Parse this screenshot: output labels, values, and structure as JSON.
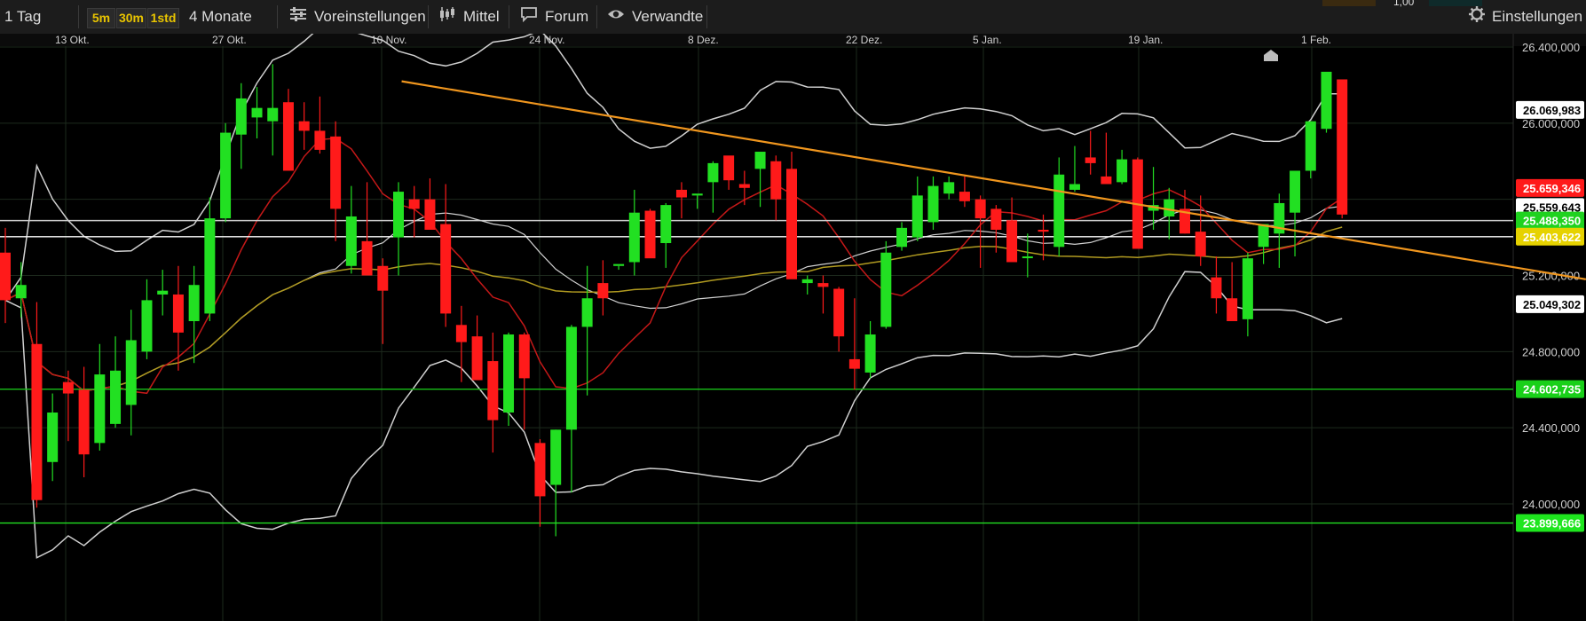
{
  "toolbar": {
    "interval": "1 Tag",
    "timeframes": [
      "5m",
      "30m",
      "1std"
    ],
    "range": "4 Monate",
    "presets": "Voreinstellungen",
    "indicator": "Mittel",
    "forum": "Forum",
    "related": "Verwandte",
    "settings": "Einstellungen"
  },
  "topright": {
    "value": "1,00"
  },
  "colors": {
    "up": "#22e022",
    "down": "#ff1a1a",
    "trendline": "#f0961e",
    "bollinger": "#d0d0d0",
    "ma_red": "#c41818",
    "ma_yellow": "#b09a20",
    "grid": "#1d2a1d"
  },
  "chart_data": {
    "type": "candlestick",
    "x_ticks": [
      "13 Okt.",
      "27 Okt.",
      "10 Nov.",
      "24 Nov.",
      "8 Dez.",
      "22 Dez.",
      "5 Jan.",
      "19 Jan.",
      "1 Feb."
    ],
    "y_ticks": [
      "26.400,000",
      "26.000,000",
      "25.200,000",
      "24.800,000",
      "24.400,000",
      "24.000,000"
    ],
    "ylim": [
      23800000,
      26550000
    ],
    "candles": [
      [
        25320000,
        25450000,
        24950000,
        25070000
      ],
      [
        25080000,
        25270000,
        24980000,
        25150000
      ],
      [
        24840000,
        25060000,
        23980000,
        24020000
      ],
      [
        24220000,
        24580000,
        24120000,
        24480000
      ],
      [
        24640000,
        24700000,
        24330000,
        24580000
      ],
      [
        24600000,
        24720000,
        24140000,
        24260000
      ],
      [
        24320000,
        24840000,
        24280000,
        24680000
      ],
      [
        24420000,
        24880000,
        24400000,
        24700000
      ],
      [
        24520000,
        25020000,
        24360000,
        24860000
      ],
      [
        24800000,
        25180000,
        24760000,
        25070000
      ],
      [
        25100000,
        25230000,
        24990000,
        25120000
      ],
      [
        25100000,
        25250000,
        24700000,
        24900000
      ],
      [
        24960000,
        25250000,
        24740000,
        25150000
      ],
      [
        25000000,
        25610000,
        24960000,
        25500000
      ],
      [
        25500000,
        26000000,
        25480000,
        25950000
      ],
      [
        25940000,
        26210000,
        25760000,
        26130000
      ],
      [
        26030000,
        26190000,
        25920000,
        26080000
      ],
      [
        26010000,
        26310000,
        25830000,
        26080000
      ],
      [
        26110000,
        26180000,
        25870000,
        25750000
      ],
      [
        26010000,
        26110000,
        25860000,
        25960000
      ],
      [
        25960000,
        26140000,
        25840000,
        25860000
      ],
      [
        25930000,
        26010000,
        25380000,
        25550000
      ],
      [
        25250000,
        25670000,
        25210000,
        25510000
      ],
      [
        25380000,
        25690000,
        25210000,
        25200000
      ],
      [
        25250000,
        25290000,
        24840000,
        25120000
      ],
      [
        25400000,
        25690000,
        25200000,
        25640000
      ],
      [
        25600000,
        25670000,
        25400000,
        25550000
      ],
      [
        25600000,
        25710000,
        25600000,
        25440000
      ],
      [
        25470000,
        25680000,
        24930000,
        25000000
      ],
      [
        24940000,
        25040000,
        24640000,
        24850000
      ],
      [
        24880000,
        24990000,
        24720000,
        24650000
      ],
      [
        24750000,
        24900000,
        24270000,
        24440000
      ],
      [
        24480000,
        24900000,
        24410000,
        24890000
      ],
      [
        24890000,
        24900000,
        24390000,
        24660000
      ],
      [
        24320000,
        24340000,
        23880000,
        24040000
      ],
      [
        24100000,
        24390000,
        23830000,
        24390000
      ],
      [
        24390000,
        24940000,
        24060000,
        24930000
      ],
      [
        24930000,
        25250000,
        24570000,
        25080000
      ],
      [
        25160000,
        25280000,
        24990000,
        25080000
      ],
      [
        25250000,
        25250000,
        25230000,
        25260000
      ],
      [
        25270000,
        25650000,
        25200000,
        25530000
      ],
      [
        25540000,
        25550000,
        25360000,
        25290000
      ],
      [
        25370000,
        25580000,
        25240000,
        25570000
      ],
      [
        25650000,
        25690000,
        25500000,
        25610000
      ],
      [
        25620000,
        25620000,
        25550000,
        25630000
      ],
      [
        25690000,
        25800000,
        25530000,
        25790000
      ],
      [
        25830000,
        25740000,
        25650000,
        25700000
      ],
      [
        25680000,
        25750000,
        25570000,
        25660000
      ],
      [
        25760000,
        25830000,
        25560000,
        25850000
      ],
      [
        25800000,
        25830000,
        25490000,
        25600000
      ],
      [
        25760000,
        25850000,
        25460000,
        25180000
      ],
      [
        25160000,
        25200000,
        25100000,
        25180000
      ],
      [
        25160000,
        25200000,
        25000000,
        25140000
      ],
      [
        25130000,
        25140000,
        24800000,
        24880000
      ],
      [
        24760000,
        25080000,
        24600000,
        24710000
      ],
      [
        24690000,
        24960000,
        24660000,
        24890000
      ],
      [
        24930000,
        25380000,
        24920000,
        25320000
      ],
      [
        25350000,
        25480000,
        25330000,
        25450000
      ],
      [
        25400000,
        25720000,
        25380000,
        25620000
      ],
      [
        25480000,
        25720000,
        25440000,
        25670000
      ],
      [
        25630000,
        25720000,
        25600000,
        25690000
      ],
      [
        25640000,
        25720000,
        25560000,
        25590000
      ],
      [
        25600000,
        25620000,
        25240000,
        25500000
      ],
      [
        25550000,
        25570000,
        25320000,
        25440000
      ],
      [
        25490000,
        25610000,
        25330000,
        25270000
      ],
      [
        25300000,
        25420000,
        25190000,
        25300000
      ],
      [
        25440000,
        25520000,
        25280000,
        25430000
      ],
      [
        25350000,
        25820000,
        25300000,
        25730000
      ],
      [
        25650000,
        25880000,
        25640000,
        25680000
      ],
      [
        25820000,
        25960000,
        25730000,
        25790000
      ],
      [
        25720000,
        25950000,
        25710000,
        25680000
      ],
      [
        25690000,
        25860000,
        25680000,
        25810000
      ],
      [
        25810000,
        25820000,
        25440000,
        25340000
      ],
      [
        25540000,
        25770000,
        25440000,
        25570000
      ],
      [
        25510000,
        25660000,
        25390000,
        25600000
      ],
      [
        25550000,
        25650000,
        25420000,
        25420000
      ],
      [
        25430000,
        25620000,
        25250000,
        25300000
      ],
      [
        25190000,
        25300000,
        25000000,
        25080000
      ],
      [
        25080000,
        25270000,
        25060000,
        24960000
      ],
      [
        24970000,
        25320000,
        24880000,
        25290000
      ],
      [
        25350000,
        25440000,
        25260000,
        25470000
      ],
      [
        25420000,
        25630000,
        25240000,
        25580000
      ],
      [
        25530000,
        25720000,
        25300000,
        25750000
      ],
      [
        25750000,
        26010000,
        25710000,
        26010000
      ],
      [
        25970000,
        26180000,
        25950000,
        26270000
      ],
      [
        26230000,
        26230000,
        25500000,
        25520000
      ]
    ],
    "hlines": [
      {
        "value": 25488350,
        "color": "#cfcfcf",
        "label": "25.488,350",
        "tag_bg": "#1fd21f"
      },
      {
        "value": 25403622,
        "color": "#ffffff",
        "label": "25.403,622",
        "tag_bg": "#e6d200"
      },
      {
        "value": 24602735,
        "color": "#18c018",
        "label": "24.602,735",
        "tag_bg": "#19d019"
      },
      {
        "value": 23899666,
        "color": "#22e022",
        "label": "23.899,666",
        "tag_bg": "#1ee61e"
      }
    ],
    "value_tags": [
      {
        "value": 26069983,
        "label": "26.069,983",
        "bg": "#ffffff",
        "fg": "#000000"
      },
      {
        "value": 25659346,
        "label": "25.659,346",
        "bg": "#ff1a1a",
        "fg": "#ffffff"
      },
      {
        "value": 25559643,
        "label": "25.559,643",
        "bg": "#ffffff",
        "fg": "#000000"
      },
      {
        "value": 25049302,
        "label": "25.049,302",
        "bg": "#ffffff",
        "fg": "#000000"
      }
    ],
    "trendline": [
      [
        25.2,
        26220000
      ],
      [
        100.5,
        25180000
      ]
    ]
  }
}
